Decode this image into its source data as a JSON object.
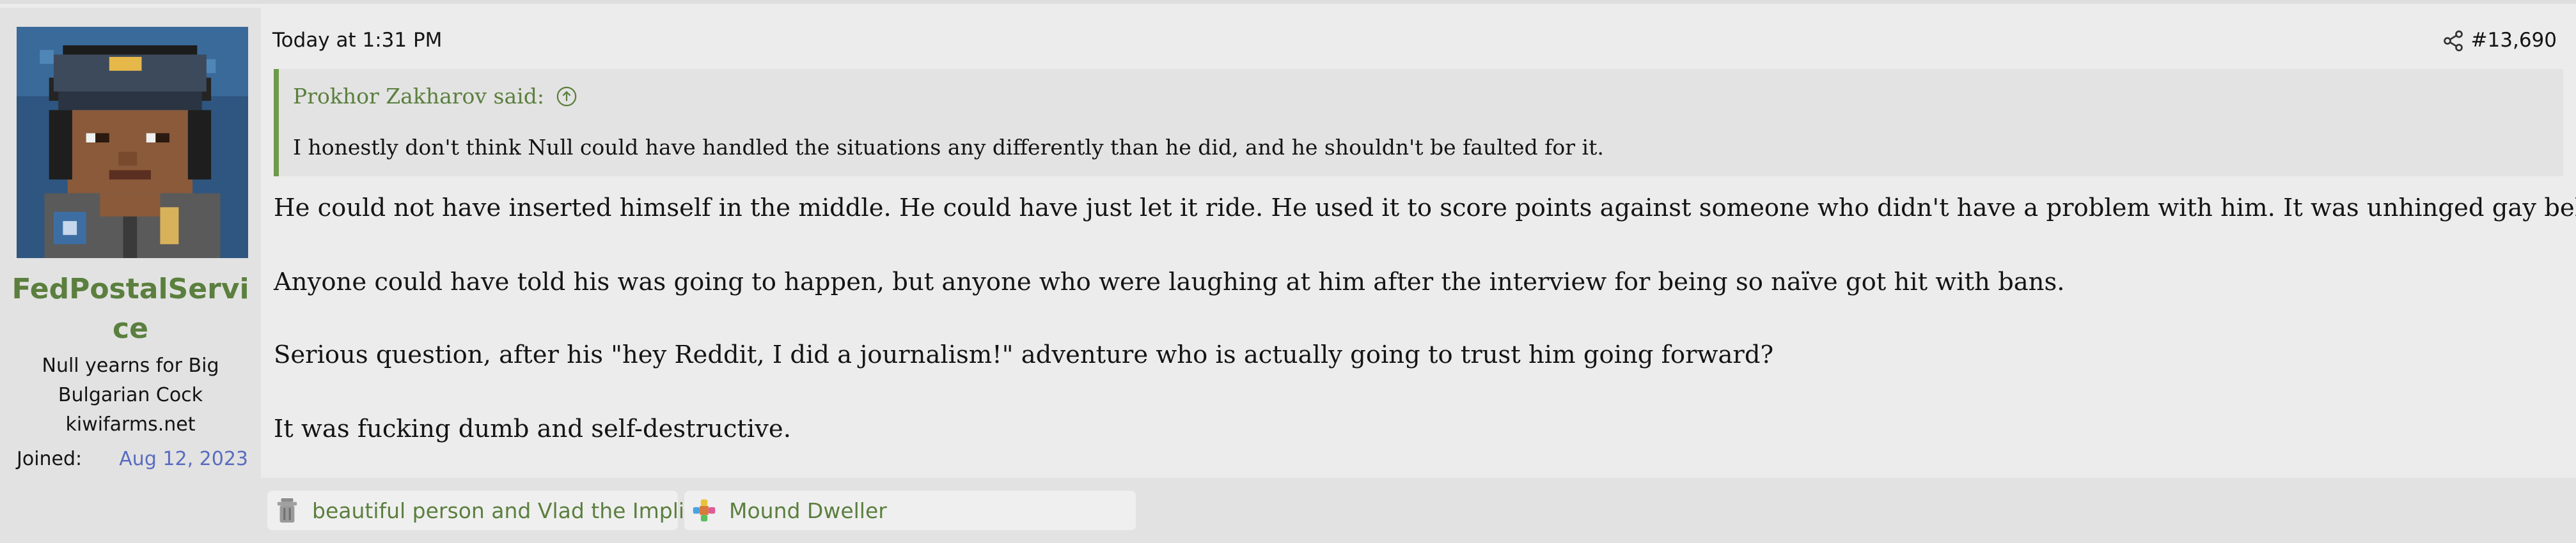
{
  "user": {
    "username": "FedPostalService",
    "title_line1": "Null yearns for Big",
    "title_line2": "Bulgarian Cock",
    "title_line3": "kiwifarms.net",
    "joined_label": "Joined:",
    "joined_value": "Aug 12, 2023",
    "avatar": "pixel-art-postal-worker-avatar"
  },
  "post": {
    "date": "Today at 1:31 PM",
    "number": "#13,690",
    "share_icon": "share-icon",
    "quote": {
      "author": "Prokhor Zakharov said:",
      "arrow_icon": "arrow-up-circle-icon",
      "text": "I honestly don't think Null could have handled the situations any differently than he did, and he shouldn't be faulted for it."
    },
    "paragraphs": [
      "He could not have inserted himself in the middle. He could have just let it ride. He used it to score points against someone who didn't have a problem with him. It was unhinged gay behaviour.",
      "Anyone could have told his was going to happen, but anyone who were laughing at him after the interview for being so naïve got hit with bans.",
      "Serious question, after his \"hey Reddit, I did a journalism!\" adventure who is actually going to trust him going forward?",
      "It was fucking dumb and self-destructive."
    ]
  },
  "reactions": [
    {
      "icon": "trashcan-icon",
      "label": "beautiful person and Vlad the Implier"
    },
    {
      "icon": "puzzle-piece-icon",
      "label": "Mound Dweller"
    }
  ],
  "colors": {
    "accent_green": "#5b7f3e",
    "quote_bar_green": "#6f9a4a",
    "link_blue": "#5a6cc0",
    "page_bg": "#ececec",
    "sidebar_bg": "#e2e2e2"
  }
}
